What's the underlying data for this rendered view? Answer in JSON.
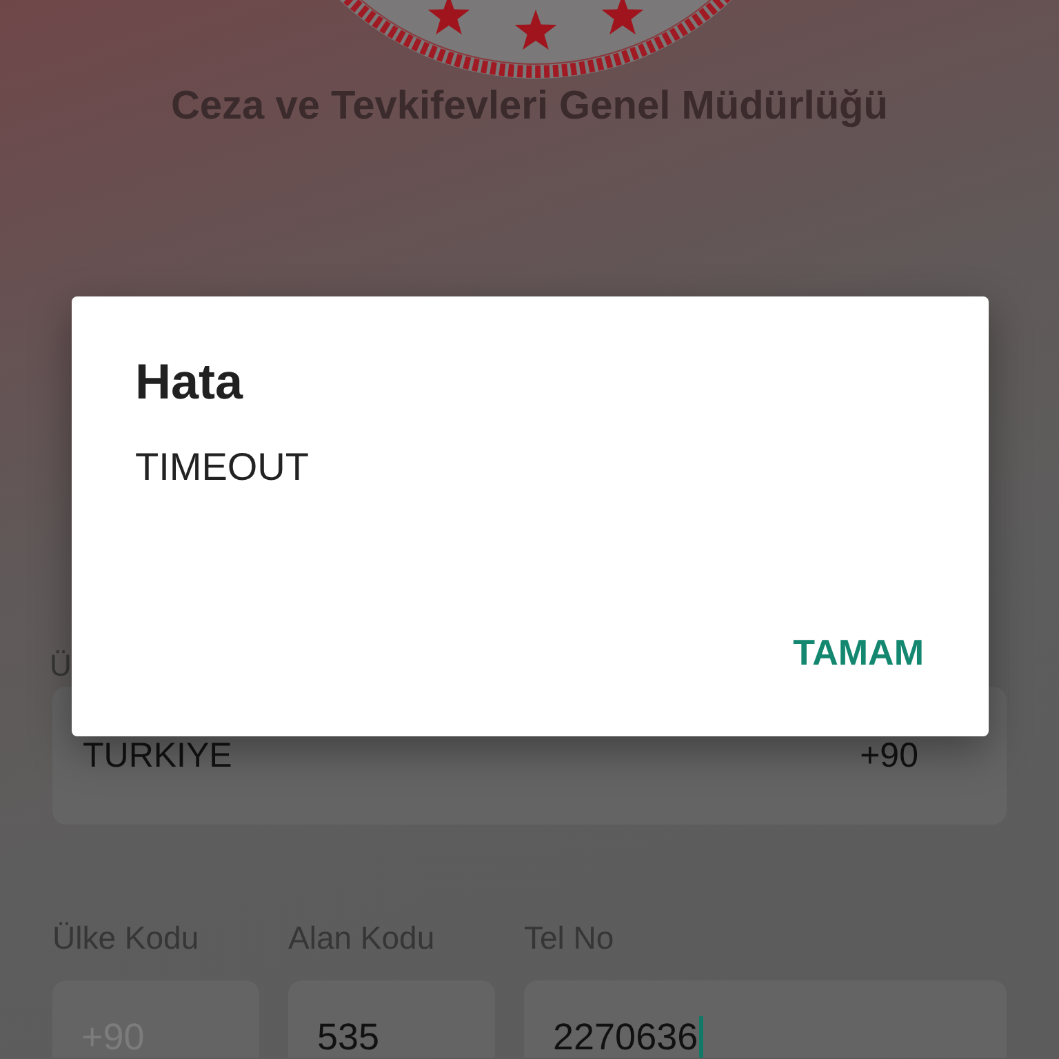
{
  "header": {
    "title": "Ceza ve Tevkifevleri Genel Müdürlüğü"
  },
  "country": {
    "label": "Ü",
    "value": "TURKIYE",
    "dial_code": "+90"
  },
  "phone": {
    "fields": [
      {
        "label": "Ülke Kodu",
        "placeholder": "+90",
        "focused": false
      },
      {
        "label": "Alan Kodu",
        "value": "535",
        "focused": false
      },
      {
        "label": "Tel No",
        "value": "2270636",
        "focused": true
      }
    ]
  },
  "dialog": {
    "title": "Hata",
    "message": "TIMEOUT",
    "buttons": [
      "TAMAM"
    ]
  }
}
